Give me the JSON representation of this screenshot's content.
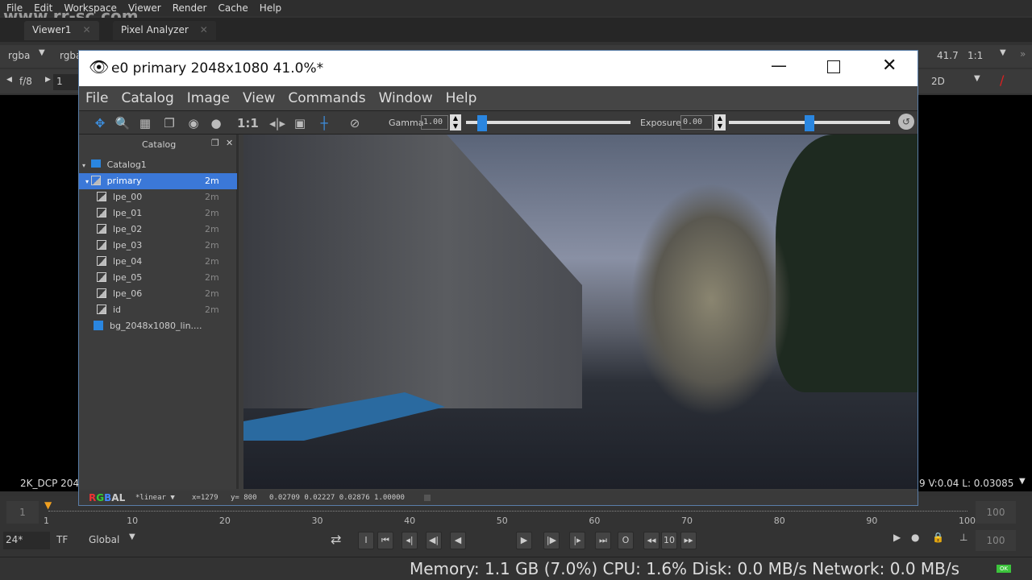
{
  "nuke": {
    "menu": [
      "File",
      "Edit",
      "Workspace",
      "Viewer",
      "Render",
      "Cache",
      "Help"
    ],
    "tabs": [
      {
        "label": "Viewer1"
      },
      {
        "label": "Pixel Analyzer"
      }
    ],
    "channels": "rgba",
    "channels2": "rgba",
    "fstop": "f/8",
    "frame_field": "1",
    "zoom": "41.7",
    "ratio": "1:1",
    "view_mode": "2D",
    "format": "2K_DCP 204",
    "pixel_info": "9 V:0.04  L: 0.03085",
    "timeline": {
      "current": "1",
      "ticks": [
        "1",
        "10",
        "20",
        "30",
        "40",
        "50",
        "60",
        "70",
        "80",
        "90",
        "100"
      ],
      "in_frame": "1",
      "out_frame": "100",
      "end_field": "100"
    },
    "fps": "24*",
    "tf": "TF",
    "scope": "Global",
    "step": "10",
    "end_field2": "100",
    "status": "Memory: 1.1 GB (7.0%) CPU: 1.6% Disk: 0.0 MB/s Network: 0.0 MB/s",
    "ok_badge": "OK",
    "watermark": "www.rr-sc.com"
  },
  "it": {
    "title": "e0 primary 2048x1080 41.0%*",
    "menu": [
      "File",
      "Catalog",
      "Image",
      "View",
      "Commands",
      "Window",
      "Help"
    ],
    "gamma_label": "Gamma",
    "gamma": "1.00",
    "gamma_level": 0.1,
    "exposure_label": "Exposure",
    "exposure": "0.00",
    "exposure_level": 0.5,
    "one_to_one": "1:1",
    "catalog": {
      "title": "Catalog",
      "root": "Catalog1",
      "items": [
        {
          "name": "primary",
          "age": "2m"
        },
        {
          "name": "lpe_00",
          "age": "2m"
        },
        {
          "name": "lpe_01",
          "age": "2m"
        },
        {
          "name": "lpe_02",
          "age": "2m"
        },
        {
          "name": "lpe_03",
          "age": "2m"
        },
        {
          "name": "lpe_04",
          "age": "2m"
        },
        {
          "name": "lpe_05",
          "age": "2m"
        },
        {
          "name": "lpe_06",
          "age": "2m"
        },
        {
          "name": "id",
          "age": "2m"
        }
      ],
      "bg": "bg_2048x1080_lin...."
    },
    "status": {
      "channels": [
        "R",
        "G",
        "B",
        "A",
        "L"
      ],
      "colorspace": "*linear",
      "x": "x=1279",
      "y": "y= 800",
      "values": "0.02709 0.02227 0.02876 1.00000"
    }
  },
  "colors": {
    "accent": "#3d7fd9",
    "selection": "#3b78d8",
    "ok": "#3cc43c"
  }
}
